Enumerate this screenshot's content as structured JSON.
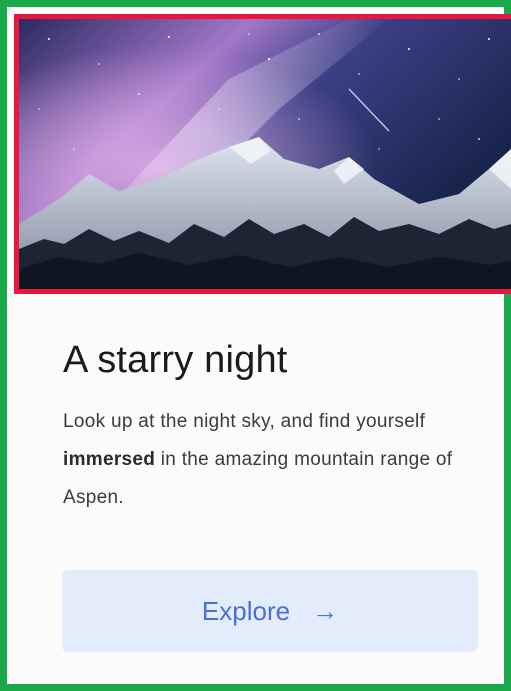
{
  "card": {
    "image_alt": "Starry night sky over snowy mountain range",
    "title": "A starry night",
    "description": {
      "before": "Look up at the night sky, and find yourself ",
      "emphasis": "immersed",
      "after": " in the amazing mountain range of Aspen."
    },
    "button": {
      "label": "Explore",
      "arrow": "→"
    }
  },
  "colors": {
    "frame_border": "#1aa84a",
    "image_border": "#e8173f",
    "button_bg": "#e3ecfb",
    "button_text": "#4b6fd6"
  },
  "icons": {
    "button_arrow": "arrow-right-icon"
  }
}
